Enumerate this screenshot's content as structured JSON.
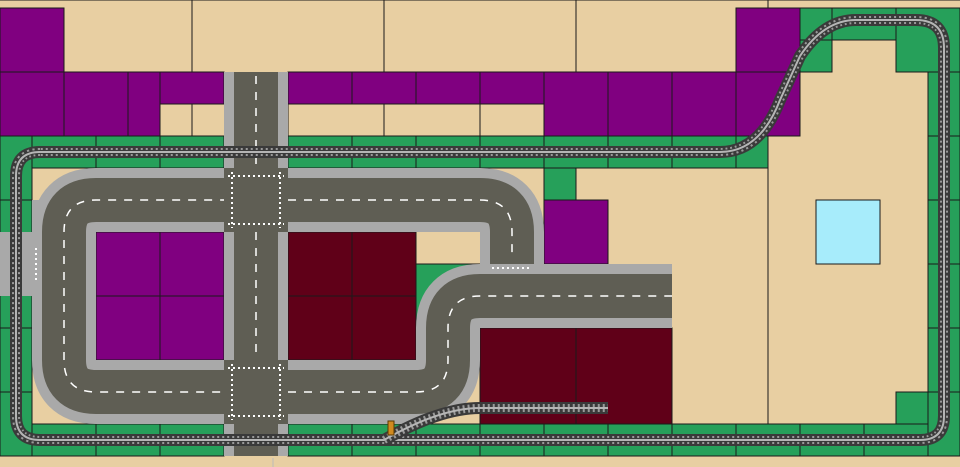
{
  "layout_editor": {
    "colors": {
      "sand": "#e8cfa2",
      "purple": "#800080",
      "maroon": "#600018",
      "grass": "#26a05a",
      "road": "#5f5e54",
      "sidewalk": "#a9a9a9",
      "sidewalk_stripe": "#c8c8c8",
      "lane_dash": "#ffffff",
      "rail": "#3a3a3a",
      "sleeper": "#7a7a7a",
      "water": "#a7ecfb",
      "grid_line": "#1a1a1a",
      "signal": "#d08a20"
    },
    "tile_types": [
      "baseplate-tan",
      "baseplate-purple",
      "baseplate-dark-red",
      "baseplate-green",
      "road-straight",
      "road-curve",
      "road-crossroad",
      "road-t-junction",
      "rail-straight",
      "rail-curve",
      "rail-switch",
      "water-plate"
    ],
    "icons": [
      "crossing-signal-icon"
    ]
  }
}
